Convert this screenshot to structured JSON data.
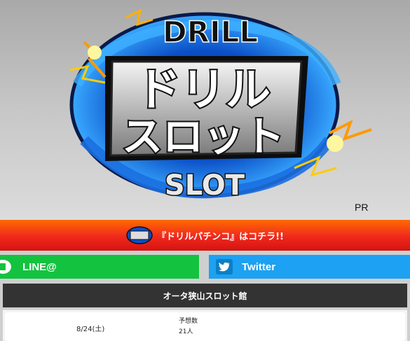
{
  "hero": {
    "logo_top": "DRILL",
    "logo_main_1": "ドリル",
    "logo_main_2": "スロット",
    "logo_bottom": "SLOT",
    "pr": "PR"
  },
  "banner": {
    "text": "『ドリルパチンコ』はコチラ!!",
    "logo_small": "ドリル パチンコ"
  },
  "social": {
    "line_label": "LINE@",
    "twitter_label": "Twitter",
    "line_color": "#13c33f",
    "twitter_color": "#1da1f2"
  },
  "store": {
    "name": "オータ狭山スロット館",
    "date": "8/24(土)",
    "prediction_label": "予想数",
    "prediction_value": "21人"
  }
}
